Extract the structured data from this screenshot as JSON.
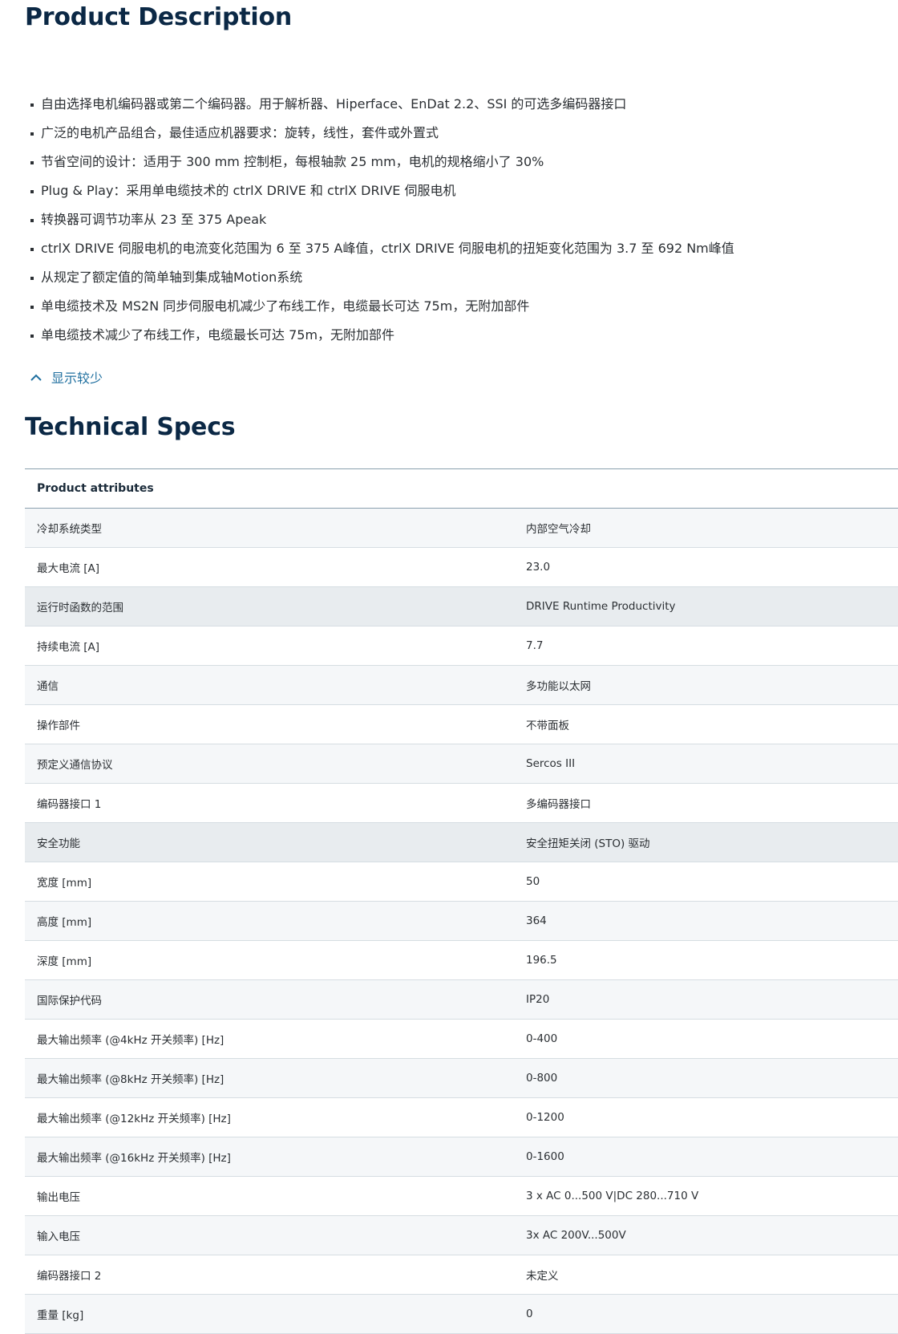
{
  "description": {
    "title": "Product Description",
    "bullets": [
      "自由选择电机编码器或第二个编码器。用于解析器、Hiperface、EnDat 2.2、SSI 的可选多编码器接口",
      "广泛的电机产品组合，最佳适应机器要求：旋转，线性，套件或外置式",
      "节省空间的设计：适用于 300 mm 控制柜，每根轴款 25 mm，电机的规格缩小了 30%",
      "Plug & Play：采用单电缆技术的 ctrlX DRIVE 和 ctrlX DRIVE 伺服电机",
      "转换器可调节功率从 23 至 375 Apeak",
      "ctrlX DRIVE 伺服电机的电流变化范围为 6 至 375 A峰值，ctrlX DRIVE 伺服电机的扭矩变化范围为 3.7 至 692 Nm峰值",
      "从规定了额定值的简单轴到集成轴Motion系统",
      "单电缆技术及 MS2N 同步伺服电机减少了布线工作，电缆最长可达 75m，无附加部件",
      "单电缆技术减少了布线工作，电缆最长可达 75m，无附加部件"
    ],
    "show_less_label": "显示较少",
    "show_less_icon": "chevron-up-icon"
  },
  "specs": {
    "title": "Technical Specs",
    "header": "Product attributes",
    "rows": [
      {
        "key": "冷却系统类型",
        "value": "内部空气冷却"
      },
      {
        "key": "最大电流 [A]",
        "value": "23.0"
      },
      {
        "key": "运行时函数的范围",
        "value": "DRIVE Runtime Productivity"
      },
      {
        "key": "持续电流 [A]",
        "value": "7.7"
      },
      {
        "key": "通信",
        "value": "多功能以太网"
      },
      {
        "key": "操作部件",
        "value": "不带面板"
      },
      {
        "key": "预定义通信协议",
        "value": "Sercos III"
      },
      {
        "key": "编码器接口 1",
        "value": "多编码器接口"
      },
      {
        "key": "安全功能",
        "value": "安全扭矩关闭 (STO) 驱动"
      },
      {
        "key": "宽度 [mm]",
        "value": "50"
      },
      {
        "key": "高度 [mm]",
        "value": "364"
      },
      {
        "key": "深度 [mm]",
        "value": "196.5"
      },
      {
        "key": "国际保护代码",
        "value": "IP20"
      },
      {
        "key": "最大输出频率 (@4kHz 开关频率) [Hz]",
        "value": "0-400"
      },
      {
        "key": "最大输出频率 (@8kHz 开关频率) [Hz]",
        "value": "0-800"
      },
      {
        "key": "最大输出频率 (@12kHz 开关频率) [Hz]",
        "value": "0-1200"
      },
      {
        "key": "最大输出频率 (@16kHz 开关频率) [Hz]",
        "value": "0-1600"
      },
      {
        "key": "输出电压",
        "value": "3 x AC 0...500 V|DC 280...710 V"
      },
      {
        "key": "输入电压",
        "value": "3x AC 200V...500V"
      },
      {
        "key": "编码器接口 2",
        "value": "未定义"
      },
      {
        "key": "重量 [kg]",
        "value": "0"
      }
    ]
  },
  "colors": {
    "heading": "#0b2845",
    "link": "#1f6f9f",
    "row_alt": "#f5f7f9",
    "row_highlight": "#e8ecef"
  }
}
